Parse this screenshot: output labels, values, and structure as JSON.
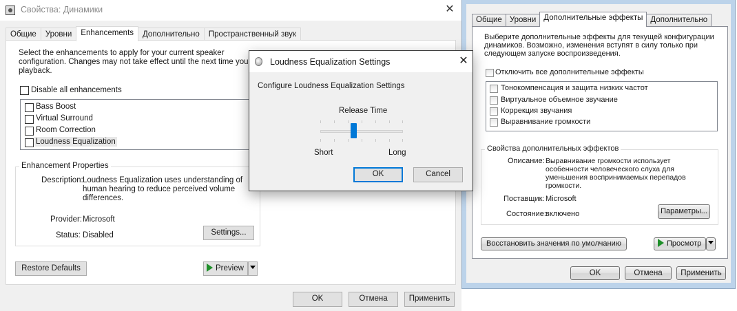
{
  "left_window": {
    "title": "Свойства: Динамики",
    "tabs": [
      "Общие",
      "Уровни",
      "Enhancements",
      "Дополнительно",
      "Пространственный звук"
    ],
    "active_tab": "Enhancements",
    "intro_line1": "Select the enhancements to apply for your current speaker",
    "intro_line2": "configuration. Changes may not take effect until the next time you st",
    "intro_line3": "playback.",
    "disable_all_label": "Disable all enhancements",
    "enhancements": [
      "Bass Boost",
      "Virtual Surround",
      "Room Correction",
      "Loudness Equalization"
    ],
    "properties_title": "Enhancement Properties",
    "description_label": "Description:",
    "description_line1": "Loudness Equalization uses understanding of",
    "description_line2": "human hearing to reduce perceived volume",
    "description_line3": "differences.",
    "provider_label": "Provider:",
    "provider_value": "Microsoft",
    "status_label": "Status:",
    "status_value": "Disabled",
    "settings_button": "Settings...",
    "restore_button": "Restore Defaults",
    "preview_button": "Preview",
    "ok_button": "OK",
    "cancel_button": "Отмена",
    "apply_button": "Применить"
  },
  "dialog": {
    "title": "Loudness Equalization Settings",
    "heading": "Configure Loudness Equalization Settings",
    "slider_label": "Release Time",
    "slider_min_label": "Short",
    "slider_max_label": "Long",
    "slider_position": 0.4,
    "ok_button": "OK",
    "cancel_button": "Cancel"
  },
  "right_window": {
    "tabs": [
      "Общие",
      "Уровни",
      "Дополнительные эффекты",
      "Дополнительно"
    ],
    "active_tab": "Дополнительные эффекты",
    "intro_line1": "Выберите дополнительные эффекты для текущей конфигурации",
    "intro_line2": "динамиков. Возможно, изменения вступят в силу только при",
    "intro_line3": "следующем запуске воспроизведения.",
    "disable_all_label": "Отключить все дополнительные эффекты",
    "effects": [
      "Тонокомпенсация и защита низких частот",
      "Виртуальное объемное звучание",
      "Коррекция звучания",
      "Выравнивание громкости"
    ],
    "properties_title": "Свойства дополнительных эффектов",
    "description_label": "Описание:",
    "description_line1": "Выравнивание громкости использует",
    "description_line2": "особенности человеческого слуха для",
    "description_line3": "уменьшения воспринимаемых перепадов",
    "description_line4": "громкости.",
    "provider_label": "Поставщик:",
    "provider_value": "Microsoft",
    "status_label": "Состояние:",
    "status_value": "включено",
    "params_button": "Параметры...",
    "restore_button": "Восстановить значения по умолчанию",
    "preview_button": "Просмотр",
    "ok_button": "OK",
    "cancel_button": "Отмена",
    "apply_button": "Применить"
  },
  "colors": {
    "accent": "#0078d7",
    "play_green": "#1f8f2a",
    "win7_frame": "#bcd3ea"
  }
}
